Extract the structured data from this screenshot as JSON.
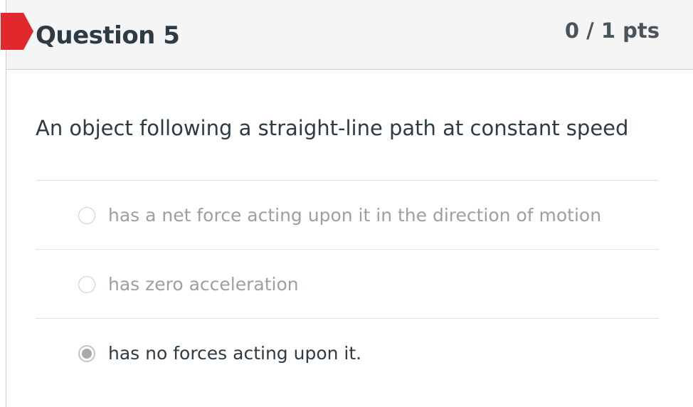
{
  "question": {
    "title": "Question 5",
    "points": "0 / 1 pts",
    "text": "An object following a straight-line path at constant speed",
    "flag_color": "#e0282d",
    "incorrect_flag_icon": "incorrect-flag-icon"
  },
  "answers": [
    {
      "label": "has a net force acting upon it in the direction of motion",
      "selected": false
    },
    {
      "label": "has zero acceleration",
      "selected": false
    },
    {
      "label": "has no forces acting upon it.",
      "selected": true
    }
  ]
}
